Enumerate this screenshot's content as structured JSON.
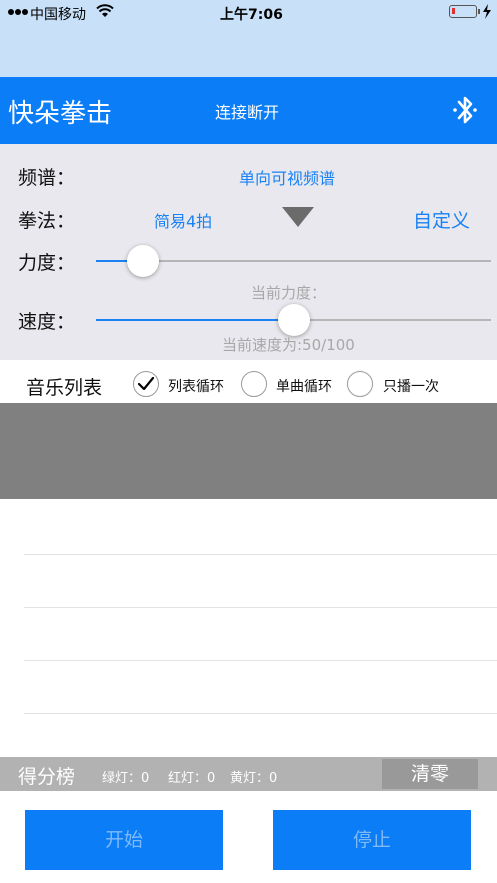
{
  "status_bar": {
    "carrier": "中国移动",
    "time": "上午7:06"
  },
  "header": {
    "app_title": "快朵拳击",
    "connection_status": "连接断开",
    "bluetooth_icon": "bluetooth-icon"
  },
  "settings": {
    "spectrum_label": "频谱：",
    "spectrum_value": "单向可视频谱",
    "method_label": "拳法：",
    "method_value": "简易4拍",
    "custom_label": "自定义",
    "strength_label": "力度：",
    "strength_value": 0.12,
    "strength_hint": "当前力度：",
    "speed_label": "速度：",
    "speed_value": 0.5,
    "speed_hint": "当前速度为:50/100",
    "accent_color": "#1a82f4"
  },
  "music": {
    "title": "音乐列表",
    "modes": [
      {
        "label": "列表循环",
        "checked": true
      },
      {
        "label": "单曲循环",
        "checked": false
      },
      {
        "label": "只播一次",
        "checked": false
      }
    ]
  },
  "score": {
    "title": "得分榜",
    "green": "绿灯：0",
    "red": "红灯：0",
    "yellow": "黄灯：0",
    "clear_label": "清零"
  },
  "buttons": {
    "start_label": "开始",
    "stop_label": "停止"
  }
}
